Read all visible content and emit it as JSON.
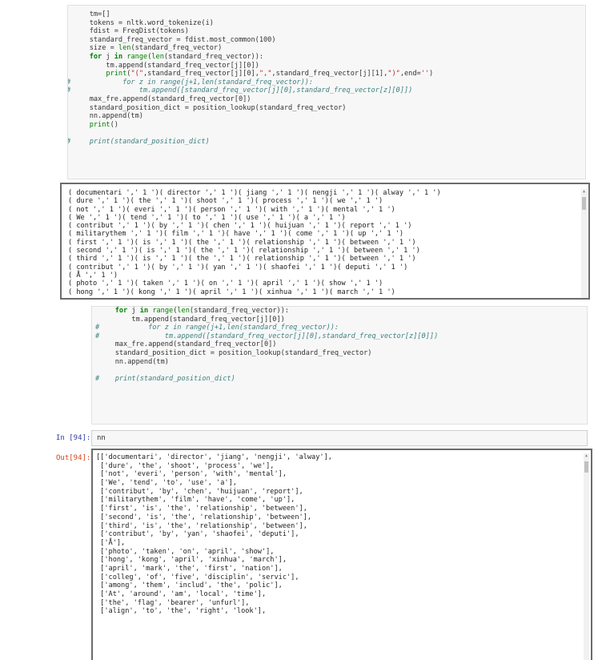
{
  "top_code_lines": [
    {
      "prefix": "",
      "text": "    tm=[]"
    },
    {
      "prefix": "",
      "text": "    tokens = nltk.word_tokenize(i)"
    },
    {
      "prefix": "",
      "text": "    fdist = FreqDist(tokens)"
    },
    {
      "prefix": "",
      "text": "    standard_freq_vector = fdist.most_common(100)"
    },
    {
      "prefix": "",
      "text": "    size = len(standard_freq_vector)"
    },
    {
      "prefix": "",
      "text": "    for j in range(len(standard_freq_vector)):"
    },
    {
      "prefix": "",
      "text": "        tm.append(standard_freq_vector[j][0])"
    },
    {
      "prefix": "",
      "text": "        print(\"(\",standard_freq_vector[j][0],\",\",standard_freq_vector[j][1],\")\",end='')"
    },
    {
      "prefix": "#",
      "text": "            for z in range(j+1,len(standard_freq_vector)):"
    },
    {
      "prefix": "#",
      "text": "                tm.append([standard_freq_vector[j][0],standard_freq_vector[z][0]])"
    },
    {
      "prefix": "",
      "text": "    max_fre.append(standard_freq_vector[0])"
    },
    {
      "prefix": "",
      "text": "    standard_position_dict = position_lookup(standard_freq_vector)"
    },
    {
      "prefix": "",
      "text": "    nn.append(tm)"
    },
    {
      "prefix": "",
      "text": "    print()"
    },
    {
      "prefix": "",
      "text": ""
    },
    {
      "prefix": "#",
      "text": "    print(standard_position_dict)"
    }
  ],
  "top_output_lines": [
    "( documentari ',' 1 ')( director ',' 1 ')( jiang ',' 1 ')( nengji ',' 1 ')( alway ',' 1 ')",
    "( dure ',' 1 ')( the ',' 1 ')( shoot ',' 1 ')( process ',' 1 ')( we ',' 1 ')",
    "( not ',' 1 ')( everi ',' 1 ')( person ',' 1 ')( with ',' 1 ')( mental ',' 1 ')",
    "( We ',' 1 ')( tend ',' 1 ')( to ',' 1 ')( use ',' 1 ')( a ',' 1 ')",
    "( contribut ',' 1 ')( by ',' 1 ')( chen ',' 1 ')( huijuan ',' 1 ')( report ',' 1 ')",
    "( militarythem ',' 1 ')( film ',' 1 ')( have ',' 1 ')( come ',' 1 ')( up ',' 1 ')",
    "( first ',' 1 ')( is ',' 1 ')( the ',' 1 ')( relationship ',' 1 ')( between ',' 1 ')",
    "( second ',' 1 ')( is ',' 1 ')( the ',' 1 ')( relationship ',' 1 ')( between ',' 1 ')",
    "( third ',' 1 ')( is ',' 1 ')( the ',' 1 ')( relationship ',' 1 ')( between ',' 1 ')",
    "( contribut ',' 1 ')( by ',' 1 ')( yan ',' 1 ')( shaofei ',' 1 ')( deputi ',' 1 ')",
    "( Å ',' 1 ')",
    "( photo ',' 1 ')( taken ',' 1 ')( on ',' 1 ')( april ',' 1 ')( show ',' 1 ')",
    "( hong ',' 1 ')( kong ',' 1 ')( april ',' 1 ')( xinhua ',' 1 ')( march ',' 1 ')"
  ],
  "bottom_code_lines": [
    {
      "prefix": "",
      "text": "    for j in range(len(standard_freq_vector)):"
    },
    {
      "prefix": "",
      "text": "        tm.append(standard_freq_vector[j][0])"
    },
    {
      "prefix": "#",
      "text": "            for z in range(j+1,len(standard_freq_vector)):"
    },
    {
      "prefix": "#",
      "text": "                tm.append([standard_freq_vector[j][0],standard_freq_vector[z][0]])"
    },
    {
      "prefix": "",
      "text": "    max_fre.append(standard_freq_vector[0])"
    },
    {
      "prefix": "",
      "text": "    standard_position_dict = position_lookup(standard_freq_vector)"
    },
    {
      "prefix": "",
      "text": "    nn.append(tm)"
    },
    {
      "prefix": "",
      "text": ""
    },
    {
      "prefix": "#",
      "text": "    print(standard_position_dict)"
    }
  ],
  "input_cell": {
    "prompt": "In [94]:",
    "code": "nn"
  },
  "output_cell": {
    "prompt": "Out[94]:",
    "lines": [
      "[['documentari', 'director', 'jiang', 'nengji', 'alway'],",
      " ['dure', 'the', 'shoot', 'process', 'we'],",
      " ['not', 'everi', 'person', 'with', 'mental'],",
      " ['We', 'tend', 'to', 'use', 'a'],",
      " ['contribut', 'by', 'chen', 'huijuan', 'report'],",
      " ['militarythem', 'film', 'have', 'come', 'up'],",
      " ['first', 'is', 'the', 'relationship', 'between'],",
      " ['second', 'is', 'the', 'relationship', 'between'],",
      " ['third', 'is', 'the', 'relationship', 'between'],",
      " ['contribut', 'by', 'yan', 'shaofei', 'deputi'],",
      " ['Å'],",
      " ['photo', 'taken', 'on', 'april', 'show'],",
      " ['hong', 'kong', 'april', 'xinhua', 'march'],",
      " ['april', 'mark', 'the', 'first', 'nation'],",
      " ['colleg', 'of', 'five', 'disciplin', 'servic'],",
      " ['among', 'them', 'includ', 'the', 'polic'],",
      " ['At', 'around', 'am', 'local', 'time'],",
      " ['the', 'flag', 'bearer', 'unfurl'],",
      " ['align', 'to', 'the', 'right', 'look'],"
    ]
  },
  "colors": {
    "comment": "#408080",
    "keyword": "#008000",
    "string": "#ba2121",
    "in_prompt": "#303f9f",
    "out_prompt": "#d84315"
  }
}
